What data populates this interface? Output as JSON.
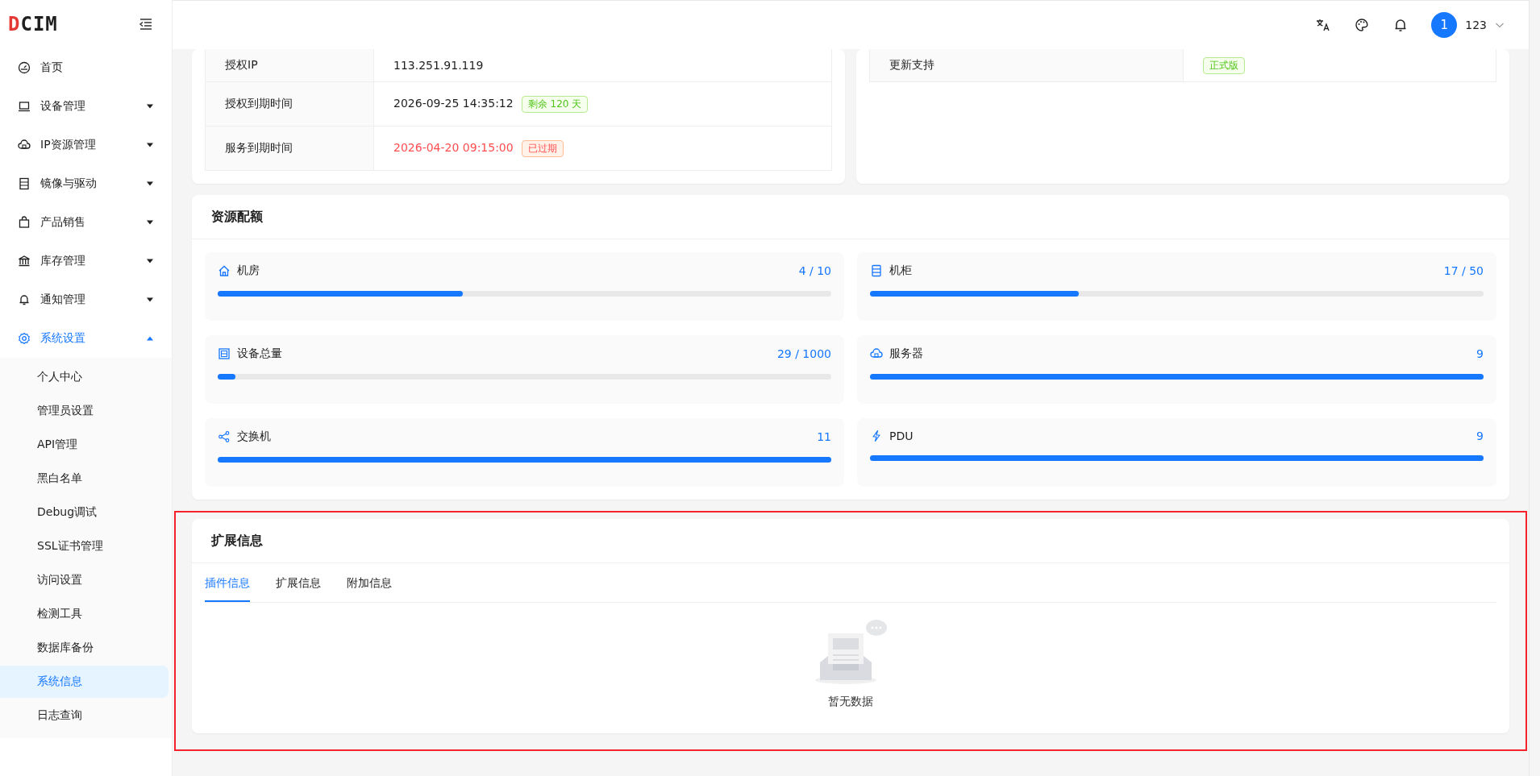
{
  "header": {
    "logo": "DCIM",
    "avatar": "1",
    "user_name": "123"
  },
  "sidebar": {
    "items": [
      {
        "label": "首页",
        "selected": false
      },
      {
        "label": "设备管理",
        "selected": false,
        "expanded": false
      },
      {
        "label": "IP资源管理",
        "selected": false,
        "expanded": false
      },
      {
        "label": "镜像与驱动",
        "selected": false,
        "expanded": false
      },
      {
        "label": "产品销售",
        "selected": false,
        "expanded": false
      },
      {
        "label": "库存管理",
        "selected": false,
        "expanded": false
      },
      {
        "label": "通知管理",
        "selected": false,
        "expanded": false
      },
      {
        "label": "系统设置",
        "selected": true,
        "expanded": true,
        "children": [
          {
            "label": "个人中心",
            "selected": false
          },
          {
            "label": "管理员设置",
            "selected": false
          },
          {
            "label": "API管理",
            "selected": false
          },
          {
            "label": "黑白名单",
            "selected": false
          },
          {
            "label": "Debug调试",
            "selected": false
          },
          {
            "label": "SSL证书管理",
            "selected": false
          },
          {
            "label": "访问设置",
            "selected": false
          },
          {
            "label": "检测工具",
            "selected": false
          },
          {
            "label": "数据库备份",
            "selected": false
          },
          {
            "label": "系统信息",
            "selected": true
          },
          {
            "label": "日志查询",
            "selected": false
          }
        ]
      }
    ]
  },
  "license_table": {
    "rows": [
      {
        "label": "授权IP",
        "value": "113.251.91.119",
        "expired": false
      },
      {
        "label": "授权到期时间",
        "value": "2026-09-25 14:35:12",
        "expired": false,
        "tag": {
          "text": "剩余 120 天",
          "kind": "success"
        }
      },
      {
        "label": "服务到期时间",
        "value": "2026-04-20 09:15:00",
        "expired": true,
        "tag": {
          "text": "已过期",
          "kind": "error"
        }
      }
    ]
  },
  "update_table": {
    "rows": [
      {
        "label": "更新支持",
        "tag": {
          "text": "正式版",
          "kind": "success"
        }
      }
    ]
  },
  "resource_quota": {
    "title": "资源配额",
    "items": [
      {
        "name": "机房",
        "reading": "4 / 10",
        "level": 0.4
      },
      {
        "name": "机柜",
        "reading": "17 / 50",
        "level": 0.34
      },
      {
        "name": "设备总量",
        "reading": "29 / 1000",
        "level": 0.029
      },
      {
        "name": "服务器",
        "reading": "9",
        "level": 1
      },
      {
        "name": "交换机",
        "reading": "11",
        "level": 1
      },
      {
        "name": "PDU",
        "reading": "9",
        "level": 1
      }
    ]
  },
  "extension": {
    "title": "扩展信息",
    "highlighted": true,
    "tabs": [
      {
        "label": "插件信息",
        "selected": true
      },
      {
        "label": "扩展信息",
        "selected": false
      },
      {
        "label": "附加信息",
        "selected": false
      }
    ],
    "empty_text": "暂无数据"
  }
}
